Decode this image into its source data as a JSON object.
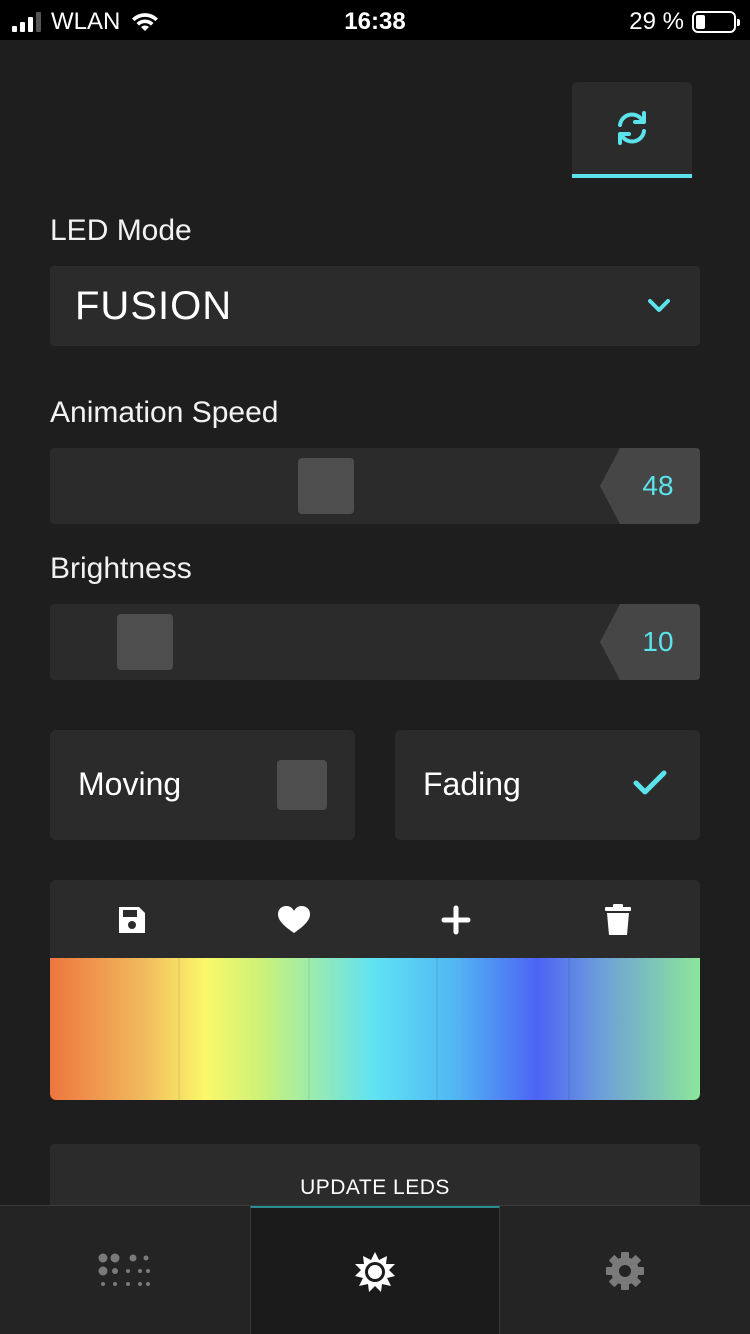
{
  "status_bar": {
    "carrier": "WLAN",
    "time": "16:38",
    "battery_text": "29 %",
    "battery_level": 0.29,
    "signal_bars": 3
  },
  "toolbar": {
    "refresh_icon": "refresh-icon"
  },
  "led_mode": {
    "label": "LED Mode",
    "value": "FUSION",
    "chevron_icon": "chevron-down-icon"
  },
  "animation_speed": {
    "label": "Animation Speed",
    "value": "48",
    "level": 0.48
  },
  "brightness": {
    "label": "Brightness",
    "value": "10",
    "level": 0.1
  },
  "options": {
    "moving": {
      "label": "Moving",
      "checked": false
    },
    "fading": {
      "label": "Fading",
      "checked": true
    }
  },
  "palette": {
    "tools": [
      "save-icon",
      "heart-icon",
      "plus-icon",
      "trash-icon"
    ],
    "colors": [
      "#ee7640",
      "#fbf86a",
      "#5fe2f4",
      "#4d63f5",
      "#8be79a"
    ]
  },
  "update_button": {
    "label": "UPDATE LEDS"
  },
  "tabbar": {
    "tabs": [
      {
        "icon": "dots-grid-icon",
        "active": false
      },
      {
        "icon": "sun-icon",
        "active": true
      },
      {
        "icon": "gear-icon",
        "active": false
      }
    ]
  },
  "colors": {
    "accent": "#5be3ec",
    "card": "#2b2b2b",
    "background": "#1e1e1e"
  }
}
